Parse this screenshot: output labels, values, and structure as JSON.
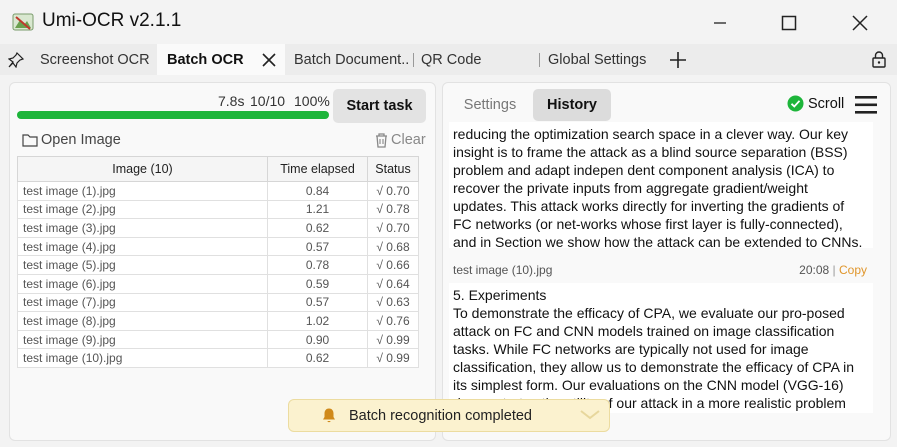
{
  "window": {
    "title": "Umi-OCR v2.1.1"
  },
  "tabs": [
    {
      "label": "Screenshot OCR",
      "active": false
    },
    {
      "label": "Batch OCR",
      "active": true
    },
    {
      "label": "Batch Document...",
      "active": false
    },
    {
      "label": "QR Code",
      "active": false
    },
    {
      "label": "Global Settings",
      "active": false
    }
  ],
  "left": {
    "progress": {
      "time": "7.8s",
      "count": "10/10",
      "percent": "100%",
      "fraction": 1.0
    },
    "start_label": "Start task",
    "open_image_label": "Open Image",
    "clear_label": "Clear",
    "table": {
      "headers": [
        "Image (10)",
        "Time elapsed",
        "Status"
      ],
      "rows": [
        [
          "test image (1).jpg",
          "0.84",
          "√ 0.70"
        ],
        [
          "test image (2).jpg",
          "1.21",
          "√ 0.78"
        ],
        [
          "test image (3).jpg",
          "0.62",
          "√ 0.70"
        ],
        [
          "test image (4).jpg",
          "0.57",
          "√ 0.68"
        ],
        [
          "test image (5).jpg",
          "0.78",
          "√ 0.66"
        ],
        [
          "test image (6).jpg",
          "0.59",
          "√ 0.64"
        ],
        [
          "test image (7).jpg",
          "0.57",
          "√ 0.63"
        ],
        [
          "test image (8).jpg",
          "1.02",
          "√ 0.76"
        ],
        [
          "test image (9).jpg",
          "0.90",
          "√ 0.99"
        ],
        [
          "test image (10).jpg",
          "0.62",
          "√ 0.99"
        ]
      ]
    }
  },
  "right": {
    "tabs": {
      "settings": "Settings",
      "history": "History"
    },
    "scroll_label": "Scroll",
    "block1_lines": [
      "reducing the optimization search space in a clever way. Our key",
      "insight is to frame the attack as a blind source separation (BSS)",
      "problem and adapt indepen dent component analysis (ICA) to",
      "recover the private inputs from aggregate gradient/weight",
      "updates. This attack works directly for inverting the gradients of",
      "FC networks (or net-works whose first layer is fully-connected),",
      "and in Section we show how the attack can be extended to CNNs."
    ],
    "block2": {
      "filename": "test image (10).jpg",
      "time": "20:08",
      "copy_label": "Copy",
      "lines": [
        "5. Experiments",
        "To demonstrate the efficacy of CPA, we evaluate our pro-posed",
        "attack on FC and CNN models trained on image classification",
        "tasks. While FC networks are typically not used for image",
        "classification, they allow us to demonstrate the efficacy of CPA in",
        "its simplest form. Our evaluations on the CNN model (VGG-16)",
        "demonstrates the utility of our attack in a more realistic problem"
      ]
    }
  },
  "toast": {
    "message": "Batch recognition completed"
  },
  "colors": {
    "progress": "#1db53a",
    "check": "#1db53a",
    "copy": "#e0962c",
    "toast_bg": "#fbf2cf"
  }
}
